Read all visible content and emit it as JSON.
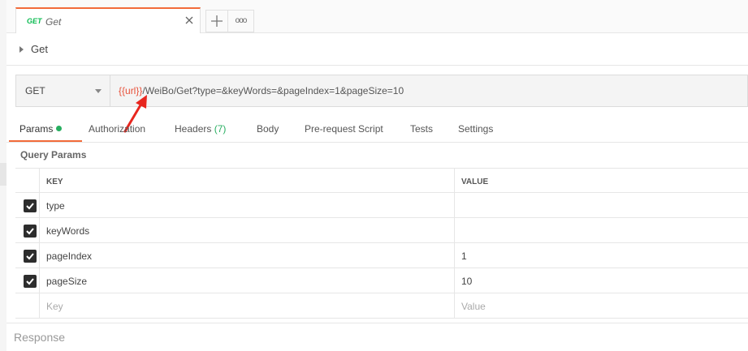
{
  "tab": {
    "method": "GET",
    "name": "Get"
  },
  "tab_more_label": "ooo",
  "request": {
    "title": "Get"
  },
  "url": {
    "method": "GET",
    "variable": "{{url}}",
    "path": "/WeiBo/Get?type=&keyWords=&pageIndex=1&pageSize=10"
  },
  "subtabs": {
    "params": "Params",
    "authorization": "Authorization",
    "headers": "Headers",
    "headers_count": "(7)",
    "body": "Body",
    "prerequest": "Pre-request Script",
    "tests": "Tests",
    "settings": "Settings"
  },
  "query_params": {
    "title": "Query Params",
    "col_key": "KEY",
    "col_value": "VALUE",
    "rows": [
      {
        "key": "type",
        "value": ""
      },
      {
        "key": "keyWords",
        "value": ""
      },
      {
        "key": "pageIndex",
        "value": "1"
      },
      {
        "key": "pageSize",
        "value": "10"
      }
    ],
    "placeholder_key": "Key",
    "placeholder_value": "Value"
  },
  "response_label": "Response",
  "colors": {
    "accent": "#f26b3a",
    "status_green": "#27ae60",
    "method_green": "#0cbb52",
    "variable_red": "#e8513a",
    "arrow_red": "#e8261e"
  }
}
